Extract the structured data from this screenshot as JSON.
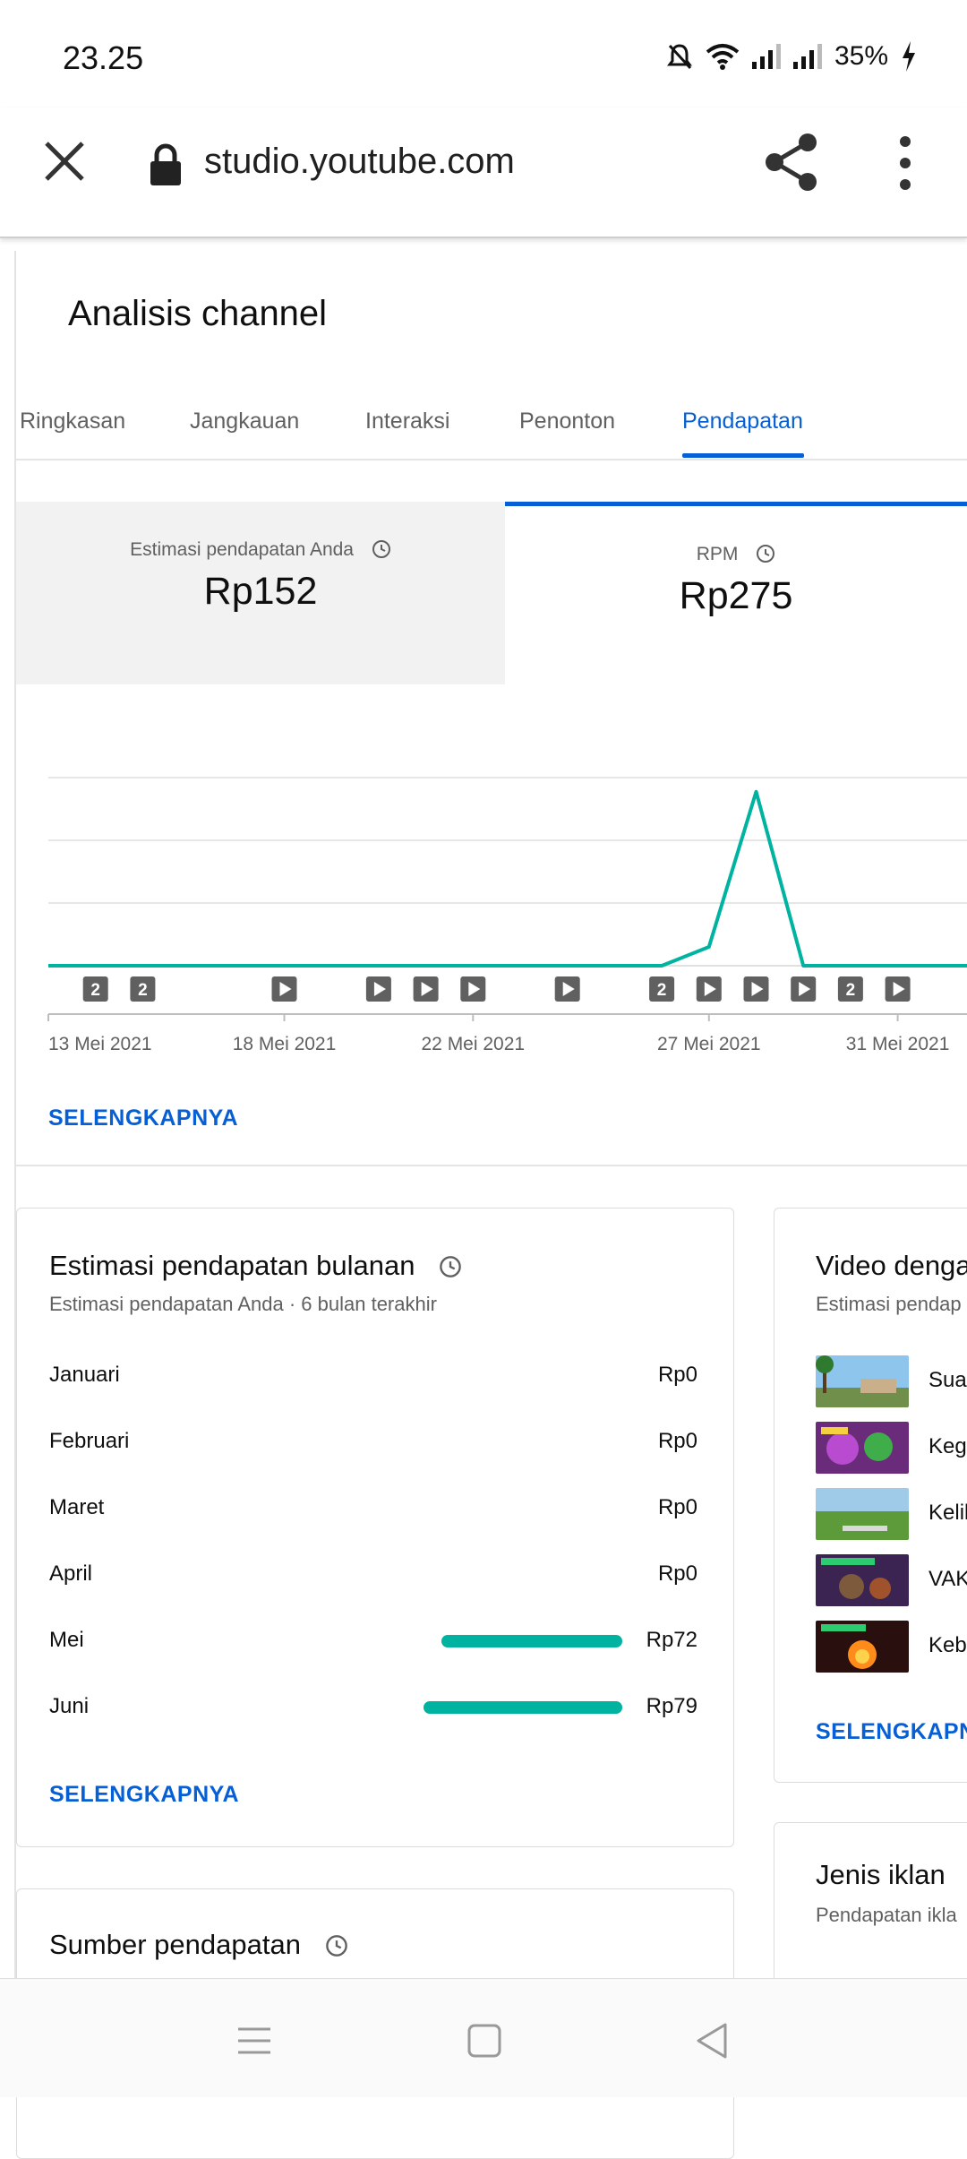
{
  "status_bar": {
    "time": "23.25",
    "battery": "35%",
    "icons": [
      "mute-bell-icon",
      "wifi-icon",
      "signal-icon",
      "signal-icon",
      "battery-charging-icon"
    ]
  },
  "browser": {
    "url": "studio.youtube.com",
    "icons": [
      "close-icon",
      "lock-icon",
      "share-icon",
      "more-vert-icon"
    ]
  },
  "page": {
    "title": "Analisis channel",
    "tabs": [
      {
        "label": "Ringkasan",
        "active": false
      },
      {
        "label": "Jangkauan",
        "active": false
      },
      {
        "label": "Interaksi",
        "active": false
      },
      {
        "label": "Penonton",
        "active": false
      },
      {
        "label": "Pendapatan",
        "active": true
      }
    ],
    "accent_color": "#065fd4",
    "series_color": "#00b3a1"
  },
  "metrics": [
    {
      "label": "Estimasi pendapatan Anda",
      "value": "Rp152",
      "selected": false
    },
    {
      "label": "RPM",
      "value": "Rp275",
      "selected": true
    }
  ],
  "chart_data": {
    "type": "line",
    "x": [
      "13 Mei",
      "14 Mei",
      "15 Mei",
      "16 Mei",
      "17 Mei",
      "18 Mei",
      "19 Mei",
      "20 Mei",
      "21 Mei",
      "22 Mei",
      "23 Mei",
      "24 Mei",
      "25 Mei",
      "26 Mei",
      "27 Mei",
      "28 Mei",
      "29 Mei",
      "30 Mei",
      "31 Mei",
      "1 Jun",
      "2 Jun"
    ],
    "series": [
      {
        "values": [
          0,
          0,
          0,
          0,
          0,
          0,
          0,
          0,
          0,
          0,
          0,
          0,
          0,
          0,
          4,
          37,
          0,
          0,
          0,
          0,
          0
        ]
      }
    ],
    "x_tick_labels": [
      "13 Mei 2021",
      "18 Mei 2021",
      "22 Mei 2021",
      "27 Mei 2021",
      "31 Mei 2021"
    ],
    "ylim": [
      0,
      40
    ],
    "grid": true,
    "markers": [
      {
        "date": "14 Mei",
        "kind": "count",
        "label": "2"
      },
      {
        "date": "15 Mei",
        "kind": "count",
        "label": "2"
      },
      {
        "date": "18 Mei",
        "kind": "video"
      },
      {
        "date": "20 Mei",
        "kind": "video"
      },
      {
        "date": "21 Mei",
        "kind": "video"
      },
      {
        "date": "22 Mei",
        "kind": "video"
      },
      {
        "date": "24 Mei",
        "kind": "video"
      },
      {
        "date": "26 Mei",
        "kind": "count",
        "label": "2"
      },
      {
        "date": "27 Mei",
        "kind": "video"
      },
      {
        "date": "28 Mei",
        "kind": "video"
      },
      {
        "date": "29 Mei",
        "kind": "video"
      },
      {
        "date": "30 Mei",
        "kind": "count",
        "label": "2"
      },
      {
        "date": "31 Mei",
        "kind": "video"
      }
    ]
  },
  "see_more_label": "SELENGKAPNYA",
  "monthly": {
    "title": "Estimasi pendapatan bulanan",
    "subtitle": "Estimasi pendapatan Anda · 6 bulan terakhir",
    "max": 79,
    "rows": [
      {
        "month": "Januari",
        "value": "Rp0",
        "amount": 0
      },
      {
        "month": "Februari",
        "value": "Rp0",
        "amount": 0
      },
      {
        "month": "Maret",
        "value": "Rp0",
        "amount": 0
      },
      {
        "month": "April",
        "value": "Rp0",
        "amount": 0
      },
      {
        "month": "Mei",
        "value": "Rp72",
        "amount": 72
      },
      {
        "month": "Juni",
        "value": "Rp79",
        "amount": 79
      }
    ]
  },
  "top_videos": {
    "title": "Video denga",
    "subtitle": "Estimasi pendap",
    "items": [
      {
        "title": "Suas"
      },
      {
        "title": "Kegi"
      },
      {
        "title": "Kelil"
      },
      {
        "title": "VAK"
      },
      {
        "title": "Keba"
      }
    ],
    "see_more": "SELENGKAPNY"
  },
  "ad_types": {
    "title": "Jenis iklan",
    "subtitle": "Pendapatan ikla"
  },
  "revenue_source": {
    "title": "Sumber pendapatan"
  },
  "nav_bar": {
    "icons": [
      "menu-icon",
      "home-square-icon",
      "back-triangle-icon"
    ]
  }
}
